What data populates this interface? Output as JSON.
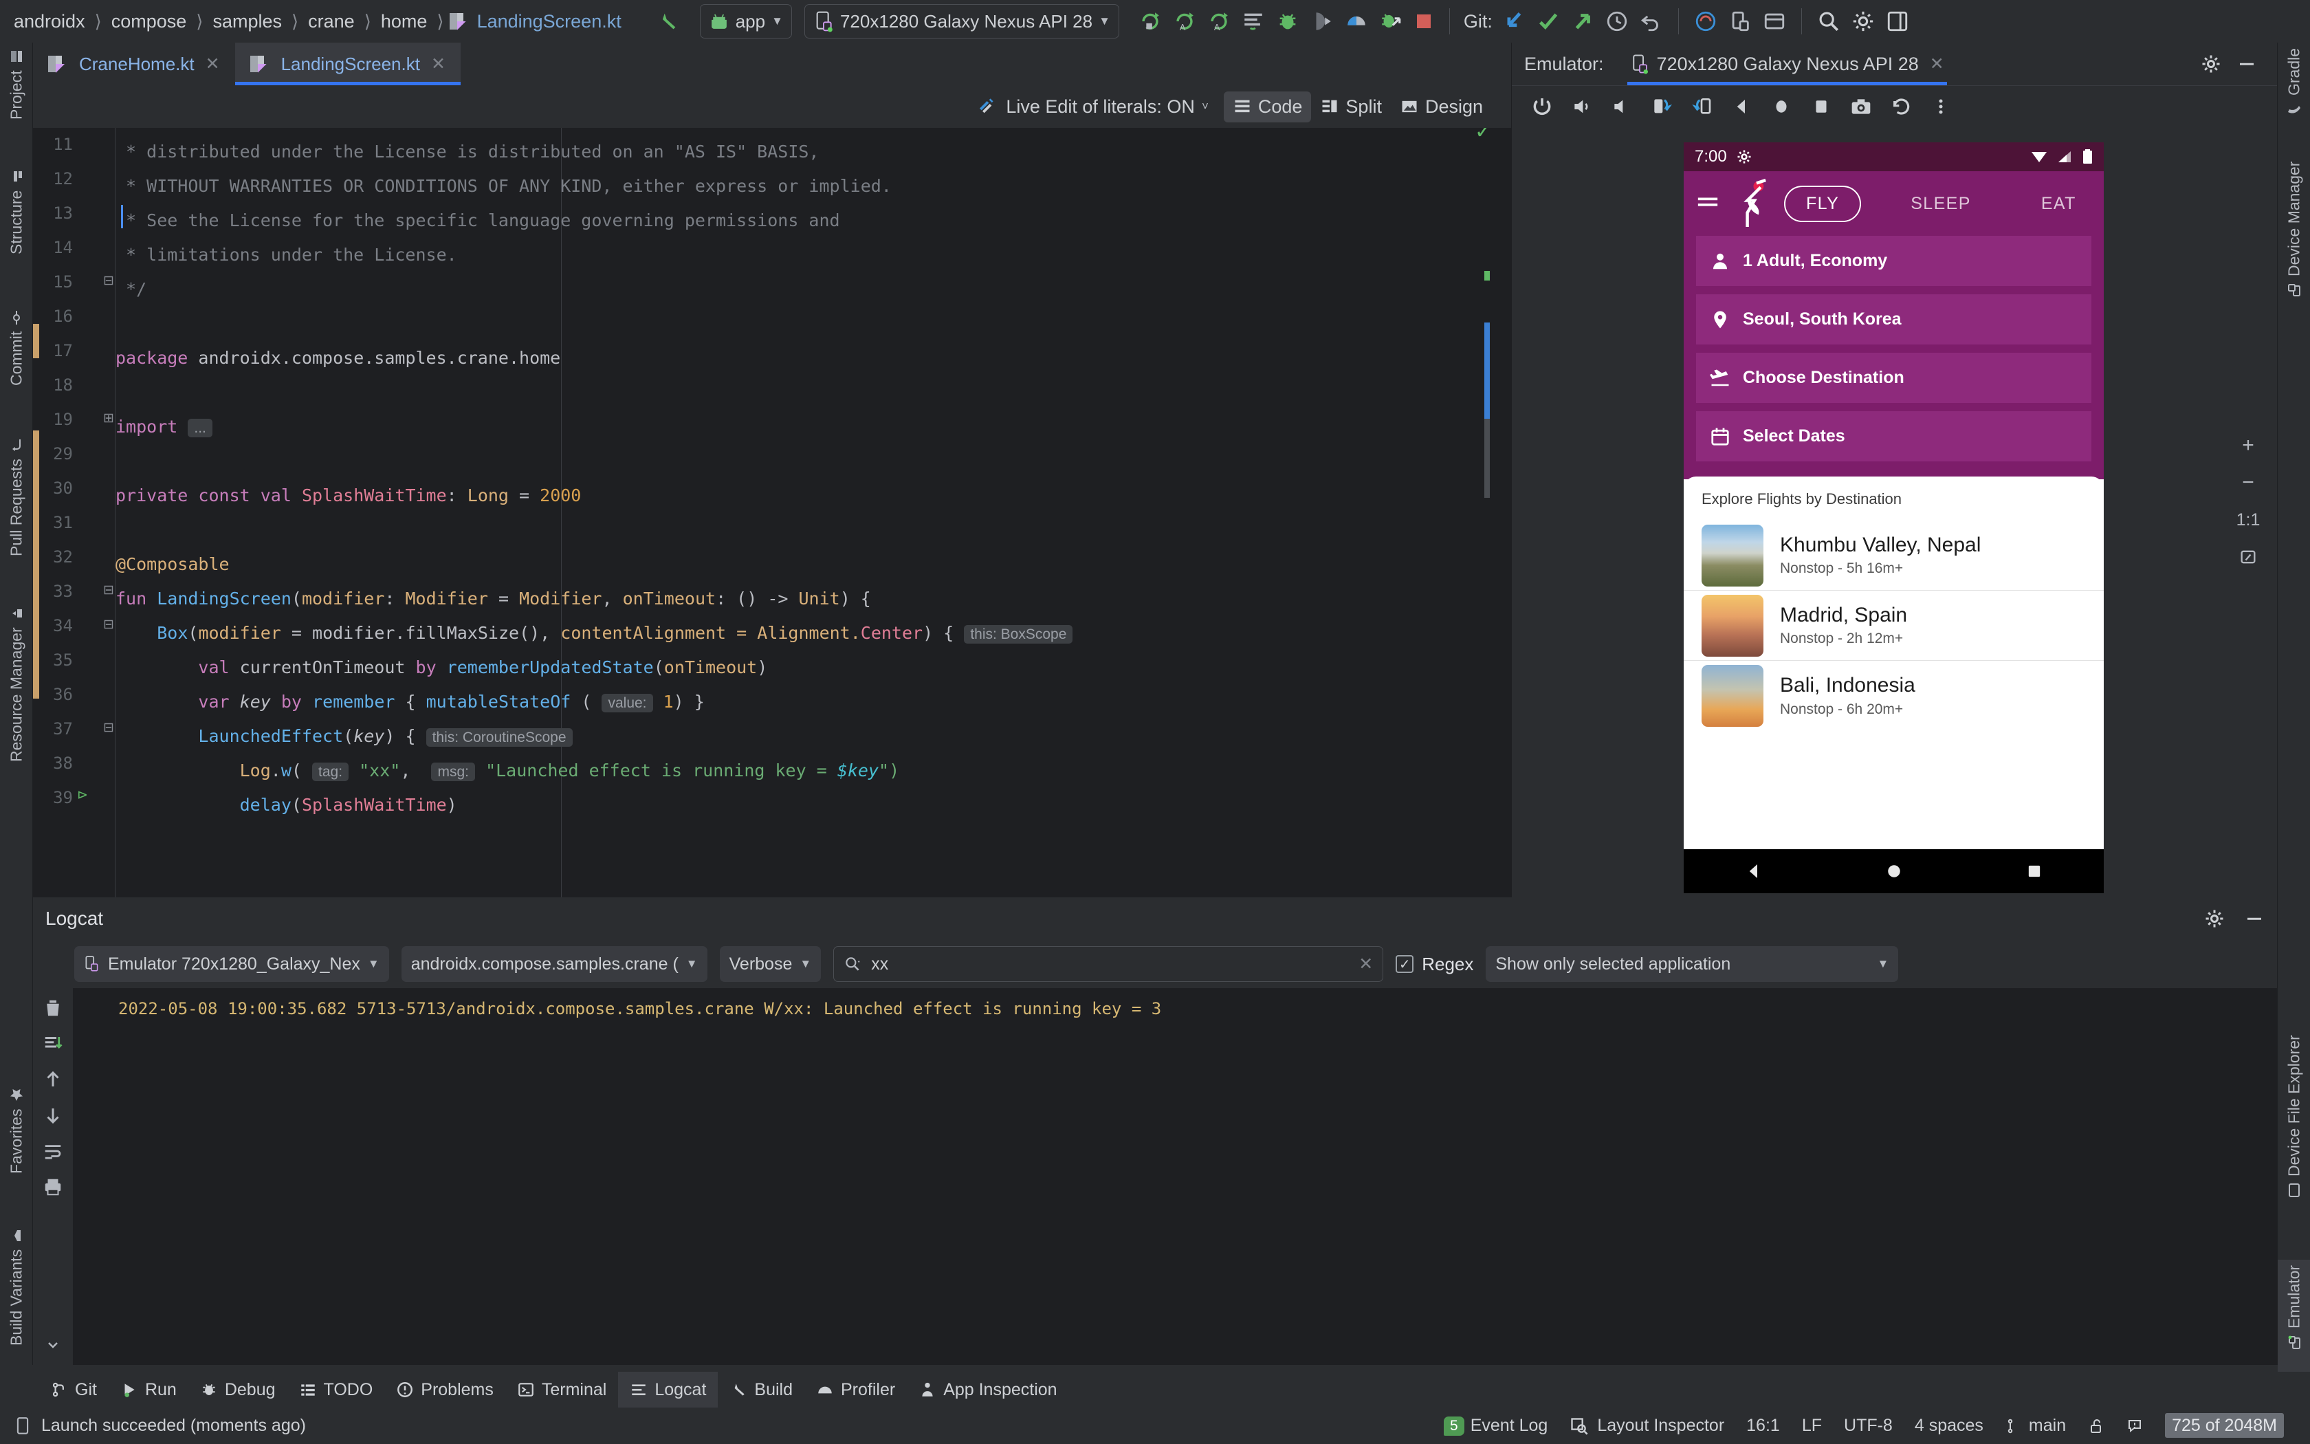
{
  "toolbar": {
    "breadcrumbs": [
      "androidx",
      "compose",
      "samples",
      "crane",
      "home"
    ],
    "breadcrumb_file": "LandingScreen.kt",
    "run_config": "app",
    "device": "720x1280 Galaxy Nexus API 28",
    "git_label": "Git:",
    "icons": {
      "back_arrow": "navigate-back-icon",
      "run": "run-icon",
      "run_with_coverage": "run-coverage-icon",
      "apply_changes": "apply-changes-icon",
      "debug": "debug-icon",
      "attach_debugger": "attach-debugger-icon",
      "profiler": "profiler-icon",
      "apply_code_changes": "apply-code-changes-icon",
      "stop": "stop-icon",
      "update_project": "git-pull-icon",
      "commit": "git-commit-icon",
      "push": "git-push-icon",
      "history": "history-icon",
      "undo": "undo-icon",
      "bug_report": "bug-report-icon",
      "device_manager": "device-manager-icon",
      "sdk": "sdk-icon",
      "search": "search-icon",
      "settings": "gear-icon",
      "layout": "layout-icon"
    }
  },
  "left_tool_strip": [
    {
      "label": "Project",
      "icon": "project-icon",
      "selected": false
    },
    {
      "label": "Structure",
      "icon": "structure-icon",
      "selected": false
    },
    {
      "label": "Commit",
      "icon": "commit-icon",
      "selected": false
    },
    {
      "label": "Pull Requests",
      "icon": "pull-requests-icon",
      "selected": false
    },
    {
      "label": "Resource Manager",
      "icon": "resource-manager-icon",
      "selected": false
    },
    {
      "label": "Favorites",
      "icon": "star-icon",
      "selected": false
    },
    {
      "label": "Build Variants",
      "icon": "build-variants-icon",
      "selected": false
    }
  ],
  "right_tool_strip": [
    {
      "label": "Gradle",
      "icon": "gradle-icon"
    },
    {
      "label": "Device Manager",
      "icon": "device-manager-icon"
    },
    {
      "label": "Device File Explorer",
      "icon": "device-file-explorer-icon"
    },
    {
      "label": "Emulator",
      "icon": "emulator-icon"
    }
  ],
  "editor": {
    "tabs": [
      {
        "label": "CraneHome.kt",
        "active": false
      },
      {
        "label": "LandingScreen.kt",
        "active": true
      }
    ],
    "live_edit_label": "Live Edit of literals: ON",
    "view_modes": [
      {
        "label": "Code",
        "selected": true
      },
      {
        "label": "Split",
        "selected": false
      },
      {
        "label": "Design",
        "selected": false
      }
    ],
    "lines": [
      {
        "num": "11",
        "segments": [
          {
            "t": " * distributed under the License is distributed on an \"AS IS\" BASIS,",
            "c": "c-com"
          }
        ]
      },
      {
        "num": "12",
        "segments": [
          {
            "t": " * WITHOUT WARRANTIES OR CONDITIONS OF ANY KIND, either express or implied.",
            "c": "c-com"
          }
        ]
      },
      {
        "num": "13",
        "segments": [
          {
            "t": " * See the License for the specific language governing permissions and",
            "c": "c-com"
          }
        ]
      },
      {
        "num": "14",
        "segments": [
          {
            "t": " * limitations under the License.",
            "c": "c-com"
          }
        ]
      },
      {
        "num": "15",
        "segments": [
          {
            "t": " */",
            "c": "c-com"
          }
        ]
      },
      {
        "num": "16",
        "segments": []
      },
      {
        "num": "17",
        "segments": [
          {
            "t": "package ",
            "c": "c-key"
          },
          {
            "t": "androidx.compose.samples.crane.home",
            "c": "c-txt"
          }
        ]
      },
      {
        "num": "18",
        "segments": []
      },
      {
        "num": "19",
        "segments": [
          {
            "t": "import ",
            "c": "c-key"
          },
          {
            "t": "...",
            "c": "c-fold"
          }
        ]
      },
      {
        "num": "29",
        "segments": []
      },
      {
        "num": "30",
        "segments": [
          {
            "t": "private const val ",
            "c": "c-key"
          },
          {
            "t": "SplashWaitTime",
            "c": "c-typ"
          },
          {
            "t": ": ",
            "c": "c-txt"
          },
          {
            "t": "Long",
            "c": "c-par"
          },
          {
            "t": " = ",
            "c": "c-txt"
          },
          {
            "t": "2000",
            "c": "c-num"
          }
        ]
      },
      {
        "num": "31",
        "segments": []
      },
      {
        "num": "32",
        "segments": [
          {
            "t": "@Composable",
            "c": "c-ann"
          }
        ]
      },
      {
        "num": "33",
        "segments": [
          {
            "t": "fun ",
            "c": "c-key"
          },
          {
            "t": "LandingScreen",
            "c": "c-fn"
          },
          {
            "t": "(",
            "c": "c-txt"
          },
          {
            "t": "modifier",
            "c": "c-par"
          },
          {
            "t": ": ",
            "c": "c-txt"
          },
          {
            "t": "Modifier",
            "c": "c-par"
          },
          {
            "t": " = ",
            "c": "c-txt"
          },
          {
            "t": "Modifier",
            "c": "c-par"
          },
          {
            "t": ", ",
            "c": "c-txt"
          },
          {
            "t": "onTimeout",
            "c": "c-par"
          },
          {
            "t": ": () -> ",
            "c": "c-txt"
          },
          {
            "t": "Unit",
            "c": "c-par"
          },
          {
            "t": ") {",
            "c": "c-txt"
          }
        ]
      },
      {
        "num": "34",
        "segments": [
          {
            "t": "    ",
            "c": "c-txt"
          },
          {
            "t": "Box",
            "c": "c-fn"
          },
          {
            "t": "(",
            "c": "c-txt"
          },
          {
            "t": "modifier",
            "c": "c-par"
          },
          {
            "t": " = modifier.",
            "c": "c-txt"
          },
          {
            "t": "fillMaxSize",
            "c": "c-txt"
          },
          {
            "t": "(), ",
            "c": "c-txt"
          },
          {
            "t": "contentAlignment",
            "c": "c-par"
          },
          {
            "t": " = Alignment.",
            "c": "c-par"
          },
          {
            "t": "Center",
            "c": "c-typ"
          },
          {
            "t": ") { ",
            "c": "c-txt"
          },
          {
            "t": "this: BoxScope",
            "c": "hint"
          }
        ]
      },
      {
        "num": "35",
        "segments": [
          {
            "t": "        ",
            "c": "c-txt"
          },
          {
            "t": "val ",
            "c": "c-key"
          },
          {
            "t": "currentOnTimeout ",
            "c": "c-txt"
          },
          {
            "t": "by ",
            "c": "c-key"
          },
          {
            "t": "rememberUpdatedState",
            "c": "c-fn"
          },
          {
            "t": "(",
            "c": "c-txt"
          },
          {
            "t": "onTimeout",
            "c": "c-par"
          },
          {
            "t": ")",
            "c": "c-txt"
          }
        ]
      },
      {
        "num": "36",
        "segments": [
          {
            "t": "        ",
            "c": "c-txt"
          },
          {
            "t": "var ",
            "c": "c-key"
          },
          {
            "t": "key ",
            "c": "c-itl"
          },
          {
            "t": "by ",
            "c": "c-key"
          },
          {
            "t": "remember ",
            "c": "c-fn"
          },
          {
            "t": "{ ",
            "c": "c-txt"
          },
          {
            "t": "mutableStateOf",
            "c": "c-fn"
          },
          {
            "t": " ( ",
            "c": "c-txt"
          },
          {
            "t": "value:",
            "c": "hint"
          },
          {
            "t": " ",
            "c": "c-txt"
          },
          {
            "t": "1",
            "c": "c-num"
          },
          {
            "t": ") }",
            "c": "c-txt"
          }
        ]
      },
      {
        "num": "37",
        "segments": [
          {
            "t": "        ",
            "c": "c-txt"
          },
          {
            "t": "LaunchedEffect",
            "c": "c-fn"
          },
          {
            "t": "(",
            "c": "c-txt"
          },
          {
            "t": "key",
            "c": "c-itl"
          },
          {
            "t": ") { ",
            "c": "c-txt"
          },
          {
            "t": "this: CoroutineScope",
            "c": "hint"
          }
        ]
      },
      {
        "num": "38",
        "segments": [
          {
            "t": "            ",
            "c": "c-txt"
          },
          {
            "t": "Log",
            "c": "c-par"
          },
          {
            "t": ".",
            "c": "c-txt"
          },
          {
            "t": "w",
            "c": "c-fn"
          },
          {
            "t": "( ",
            "c": "c-txt"
          },
          {
            "t": "tag:",
            "c": "hint"
          },
          {
            "t": " ",
            "c": "c-txt"
          },
          {
            "t": "\"xx\"",
            "c": "c-str"
          },
          {
            "t": ",  ",
            "c": "c-txt"
          },
          {
            "t": "msg:",
            "c": "hint"
          },
          {
            "t": " ",
            "c": "c-txt"
          },
          {
            "t": "\"Launched effect is running key = ",
            "c": "c-str"
          },
          {
            "t": "$key",
            "c": "c-tmp"
          },
          {
            "t": "\")",
            "c": "c-str"
          }
        ]
      },
      {
        "num": "39",
        "segments": [
          {
            "t": "            ",
            "c": "c-txt"
          },
          {
            "t": "delay",
            "c": "c-fn"
          },
          {
            "t": "(",
            "c": "c-txt"
          },
          {
            "t": "SplashWaitTime",
            "c": "c-typ"
          },
          {
            "t": ")",
            "c": "c-txt"
          }
        ]
      }
    ]
  },
  "emulator": {
    "panel_label": "Emulator:",
    "tab_label": "720x1280 Galaxy Nexus API 28",
    "toolbar_icons": [
      "power-icon",
      "volume-up-icon",
      "volume-down-icon",
      "rotate-left-icon",
      "rotate-right-icon",
      "back-icon",
      "home-icon",
      "overview-icon",
      "screenshot-icon",
      "history-icon",
      "more-vertical-icon"
    ],
    "right_controls": [
      "zoom-in-icon",
      "zoom-out-icon",
      "zoom-actual-label",
      "zoom-fit-icon"
    ],
    "zoom_actual_label": "1:1"
  },
  "device": {
    "status_bar": {
      "time": "7:00",
      "icons": [
        "gear-icon",
        "wifi-icon",
        "cellular-icon",
        "battery-icon"
      ]
    },
    "app": {
      "menu_icon": "hamburger-menu-icon",
      "logo_icon": "crane-bird-logo",
      "tabs": [
        {
          "label": "FLY",
          "selected": true
        },
        {
          "label": "SLEEP",
          "selected": false
        },
        {
          "label": "EAT",
          "selected": false
        }
      ],
      "fields": [
        {
          "icon": "person-icon",
          "label": "1 Adult, Economy"
        },
        {
          "icon": "location-pin-icon",
          "label": "Seoul, South Korea"
        },
        {
          "icon": "flight-takeoff-icon",
          "label": "Choose Destination"
        },
        {
          "icon": "calendar-icon",
          "label": "Select Dates"
        }
      ],
      "explore_title": "Explore Flights by Destination",
      "destinations": [
        {
          "name": "Khumbu Valley, Nepal",
          "detail": "Nonstop - 5h 16m+",
          "thumb": "mountain-photo"
        },
        {
          "name": "Madrid, Spain",
          "detail": "Nonstop - 2h 12m+",
          "thumb": "city-photo"
        },
        {
          "name": "Bali, Indonesia",
          "detail": "Nonstop - 6h 20m+",
          "thumb": "temple-photo"
        }
      ],
      "nav_buttons": [
        "back-icon",
        "home-icon",
        "recents-icon"
      ]
    },
    "theme": {
      "status_bar_bg": "#4d1337",
      "app_bar_bg": "#7d1d6a",
      "field_bg": "#8e2a7c",
      "accent": "#e61e4d"
    }
  },
  "logcat": {
    "title": "Logcat",
    "device_select": "Emulator 720x1280_Galaxy_Nex",
    "process_select": "androidx.compose.samples.crane (",
    "level_select": "Verbose",
    "search_value": "xx",
    "search_placeholder": "",
    "regex_label": "Regex",
    "regex_checked": true,
    "scope_select": "Show only selected application",
    "lines": [
      "2022-05-08 19:00:35.682 5713-5713/androidx.compose.samples.crane W/xx: Launched effect is running key = 3"
    ],
    "side_icons": [
      "trash-icon",
      "scroll-to-end-icon",
      "up-icon",
      "down-icon",
      "soft-wrap-icon",
      "print-icon",
      "more-icon"
    ]
  },
  "tool_window_bar": [
    {
      "label": "Git",
      "icon": "git-icon",
      "selected": false
    },
    {
      "label": "Run",
      "icon": "run-icon",
      "selected": false
    },
    {
      "label": "Debug",
      "icon": "debug-icon",
      "selected": false
    },
    {
      "label": "TODO",
      "icon": "todo-icon",
      "selected": false
    },
    {
      "label": "Problems",
      "icon": "problems-icon",
      "selected": false
    },
    {
      "label": "Terminal",
      "icon": "terminal-icon",
      "selected": false
    },
    {
      "label": "Logcat",
      "icon": "logcat-icon",
      "selected": true
    },
    {
      "label": "Build",
      "icon": "build-icon",
      "selected": false
    },
    {
      "label": "Profiler",
      "icon": "profiler-icon",
      "selected": false
    },
    {
      "label": "App Inspection",
      "icon": "app-inspection-icon",
      "selected": false
    }
  ],
  "status_bar": {
    "message": "Launch succeeded (moments ago)",
    "event_log_label": "Event Log",
    "event_log_count": "5",
    "layout_inspector_label": "Layout Inspector",
    "caret": "16:1",
    "line_sep": "LF",
    "encoding": "UTF-8",
    "indent": "4 spaces",
    "branch": "main",
    "memory": "725 of 2048M"
  }
}
